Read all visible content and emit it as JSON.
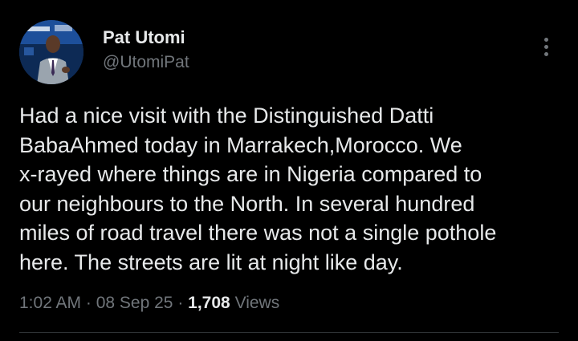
{
  "author": {
    "name": "Pat Utomi",
    "handle": "@UtomiPat"
  },
  "tweet": {
    "lines": [
      "Had a nice visit with the Distinguished Datti",
      "BabaAhmed today in Marrakech,Morocco. We",
      "x-rayed where things are in Nigeria compared to",
      "our neighbours to the North. In several hundred",
      "miles of road travel there was not a single pothole",
      "here. The streets are lit at night like day."
    ]
  },
  "meta": {
    "time": "1:02 AM",
    "separator": " · ",
    "date": "08 Sep 25",
    "views_count": "1,708",
    "views_label": " Views"
  },
  "icons": {
    "more": "more-vertical-icon"
  },
  "colors": {
    "background": "#000000",
    "primary_text": "#e7e9ea",
    "secondary_text": "#71767b",
    "divider": "#2f3336"
  }
}
